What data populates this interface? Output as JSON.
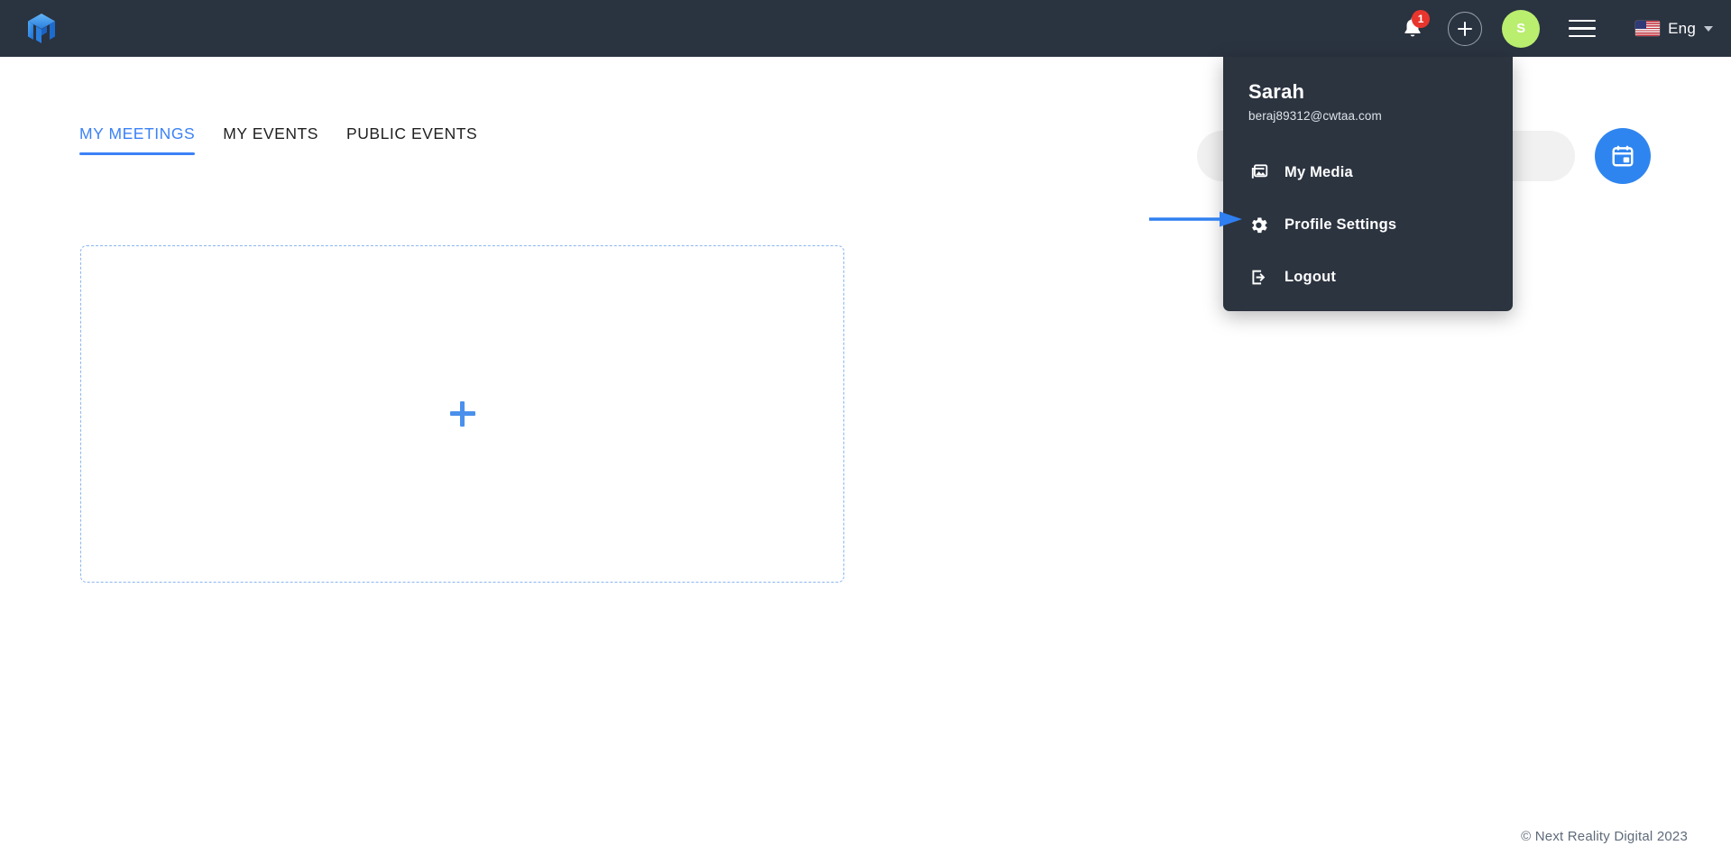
{
  "header": {
    "logo_icon": "cube-logo-icon",
    "notifications": {
      "icon": "bell-icon",
      "badge_count": "1"
    },
    "add_button": {
      "icon": "plus-icon",
      "label": "+"
    },
    "avatar": {
      "initial": "S",
      "color": "#b9ee6f"
    },
    "menu_button": {
      "icon": "hamburger-icon"
    },
    "language": {
      "flag_icon": "us-flag-icon",
      "label": "Eng",
      "caret_icon": "chevron-down-icon"
    },
    "background_color": "#2a3340"
  },
  "tabs": [
    {
      "label": "MY MEETINGS",
      "active": true
    },
    {
      "label": "MY EVENTS",
      "active": false
    },
    {
      "label": "PUBLIC EVENTS",
      "active": false
    }
  ],
  "toolbar": {
    "search_placeholder": "",
    "search_value": "",
    "calendar_button_icon": "calendar-icon"
  },
  "main": {
    "add_card": {
      "icon": "plus-icon",
      "label": ""
    }
  },
  "user_menu": {
    "name": "Sarah",
    "email": "beraj89312@cwtaa.com",
    "items": [
      {
        "label": "My Media",
        "icon": "image-stack-icon"
      },
      {
        "label": "Profile Settings",
        "icon": "gear-icon"
      },
      {
        "label": "Logout",
        "icon": "logout-icon"
      }
    ],
    "background_color": "#2c3440"
  },
  "annotation": {
    "arrow_color": "#2f7ff0",
    "points_to": "Profile Settings"
  },
  "footer": {
    "copyright": "© Next Reality Digital 2023"
  }
}
